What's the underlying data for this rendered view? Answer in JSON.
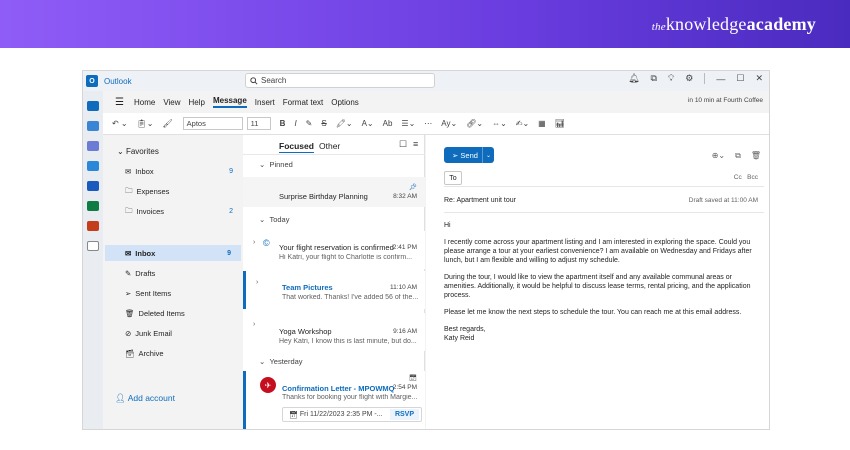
{
  "brand": {
    "the": "the",
    "knowledge": "knowledge",
    "academy": "academy"
  },
  "titlebar": {
    "app_name": "Outlook",
    "search_placeholder": "Search"
  },
  "menubar": {
    "items": [
      "Home",
      "View",
      "Help",
      "Message",
      "Insert",
      "Format text",
      "Options"
    ],
    "active": "Message",
    "appointment": "in 10 min at Fourth Coffee"
  },
  "ribbon": {
    "font": "Aptos",
    "size": "11"
  },
  "folders": {
    "favorites_label": "Favorites",
    "favorites": [
      {
        "label": "Inbox",
        "count": "9"
      },
      {
        "label": "Expenses",
        "count": ""
      },
      {
        "label": "Invoices",
        "count": "2"
      }
    ],
    "main": [
      {
        "label": "Inbox",
        "count": "9"
      },
      {
        "label": "Drafts",
        "count": ""
      },
      {
        "label": "Sent Items",
        "count": ""
      },
      {
        "label": "Deleted Items",
        "count": ""
      },
      {
        "label": "Junk Email",
        "count": ""
      },
      {
        "label": "Archive",
        "count": ""
      }
    ],
    "add_account": "Add account"
  },
  "list": {
    "tabs": [
      "Focused",
      "Other"
    ],
    "sections": [
      "Pinned",
      "Today",
      "Yesterday"
    ],
    "items": [
      {
        "subject": "Surprise Birthday Planning",
        "preview": "",
        "time": "8:32 AM"
      },
      {
        "subject": "Your flight reservation is confirmed",
        "preview": "Hi Katri, your flight to Charlotte is confirm...",
        "time": "2:41 PM"
      },
      {
        "subject": "Team Pictures",
        "preview": "That worked. Thanks! I've added 56 of the...",
        "time": "11:10 AM"
      },
      {
        "subject": "Yoga Workshop",
        "preview": "Hey Katri, I know this is last minute, but do...",
        "time": "9:16 AM"
      },
      {
        "subject": "Confirmation Letter - MPOWMQ",
        "preview": "Thanks for booking your flight with Margie...",
        "time": "2:54 PM"
      }
    ],
    "rsvp": {
      "date": "Fri 11/22/2023 2:35 PM -...",
      "button": "RSVP"
    }
  },
  "compose": {
    "send": "Send",
    "to": "To",
    "cc": "Cc",
    "bcc": "Bcc",
    "subject": "Re: Apartment unit tour",
    "draft_saved": "Draft saved at 11:00 AM",
    "body": [
      "Hi",
      "I recently come across your apartment listing and I am interested in exploring the space. Could you please arrange a tour at your earliest convenience? I am available on Wednesday and Fridays after lunch, but I am flexible and willing to adjust my schedule.",
      "During the tour, I would like to view the apartment itself and any available communal areas or amenities. Additionally, it would be helpful to discuss lease terms, rental pricing, and the application process.",
      "Please let me know the next steps to schedule the tour. You can reach me at this email address.",
      "Best regards,",
      "Katy Reid"
    ]
  }
}
